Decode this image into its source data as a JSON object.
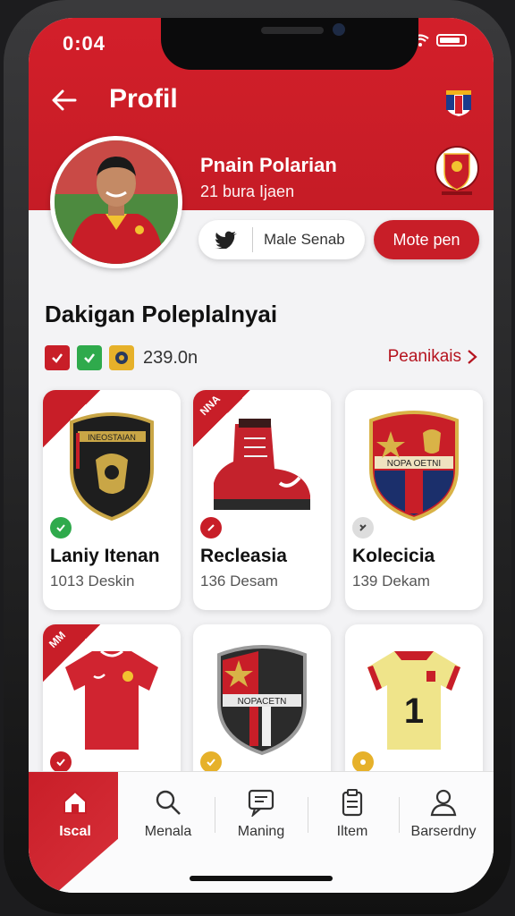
{
  "status_bar": {
    "time": "0:04"
  },
  "header": {
    "title": "Profil"
  },
  "profile": {
    "name": "Pnain Polarian",
    "subtitle": "21 bura Ijaen",
    "follow_label": "Male Senab",
    "primary_button": "Mote pen"
  },
  "collection": {
    "title": "Dakigan Poleplalnyai",
    "count": "239.0n",
    "see_all": "Peanikais"
  },
  "cards": [
    {
      "title": "Laniy Itenan",
      "subtitle": "1013 Deskin",
      "corner": "",
      "shield_text": "INEOSTAIAN"
    },
    {
      "title": "Recleasia",
      "subtitle": "136 Desam",
      "corner": "NNA"
    },
    {
      "title": "Kolecicia",
      "subtitle": "139 Dekam",
      "corner": "",
      "shield_text": "NOPA OETNI"
    },
    {
      "title": "",
      "subtitle": "",
      "corner": "MM"
    },
    {
      "title": "",
      "subtitle": "",
      "corner": "",
      "shield_text": "NOPACETN"
    },
    {
      "title": "",
      "subtitle": "",
      "corner": "",
      "shirt_number": "1"
    }
  ],
  "nav": [
    {
      "label": "Iscal",
      "icon": "home-icon"
    },
    {
      "label": "Menala",
      "icon": "search-icon"
    },
    {
      "label": "Maning",
      "icon": "message-icon"
    },
    {
      "label": "Iltem",
      "icon": "clipboard-icon"
    },
    {
      "label": "Barserdny",
      "icon": "user-icon"
    }
  ],
  "colors": {
    "accent": "#c81e28",
    "background": "#f3f3f5"
  }
}
